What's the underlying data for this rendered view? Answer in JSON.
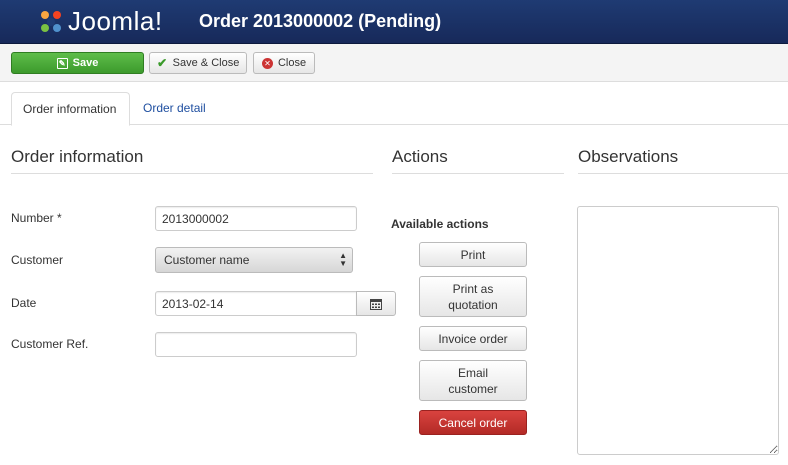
{
  "header": {
    "logo_text": "Joomla!",
    "title": "Order 2013000002 (Pending)",
    "bg_color": "#1f3b73"
  },
  "toolbar": {
    "save_label": "Save",
    "save_close_label": "Save & Close",
    "close_label": "Close",
    "save_color": "#4cae3c"
  },
  "tabs": [
    {
      "label": "Order information",
      "active": true
    },
    {
      "label": "Order detail",
      "active": false
    }
  ],
  "sections": {
    "order_info_title": "Order information",
    "actions_title": "Actions",
    "observations_title": "Observations"
  },
  "form": {
    "number": {
      "label": "Number *",
      "value": "2013000002"
    },
    "customer": {
      "label": "Customer",
      "value": "Customer name"
    },
    "date": {
      "label": "Date",
      "value": "2013-02-14"
    },
    "customer_ref": {
      "label": "Customer Ref.",
      "value": ""
    }
  },
  "actions": {
    "available_label": "Available actions",
    "print": "Print",
    "print_quotation": "Print as quotation",
    "invoice": "Invoice order",
    "email": "Email customer",
    "cancel": "Cancel order",
    "cancel_color": "#c9302c"
  },
  "observations": {
    "value": ""
  }
}
